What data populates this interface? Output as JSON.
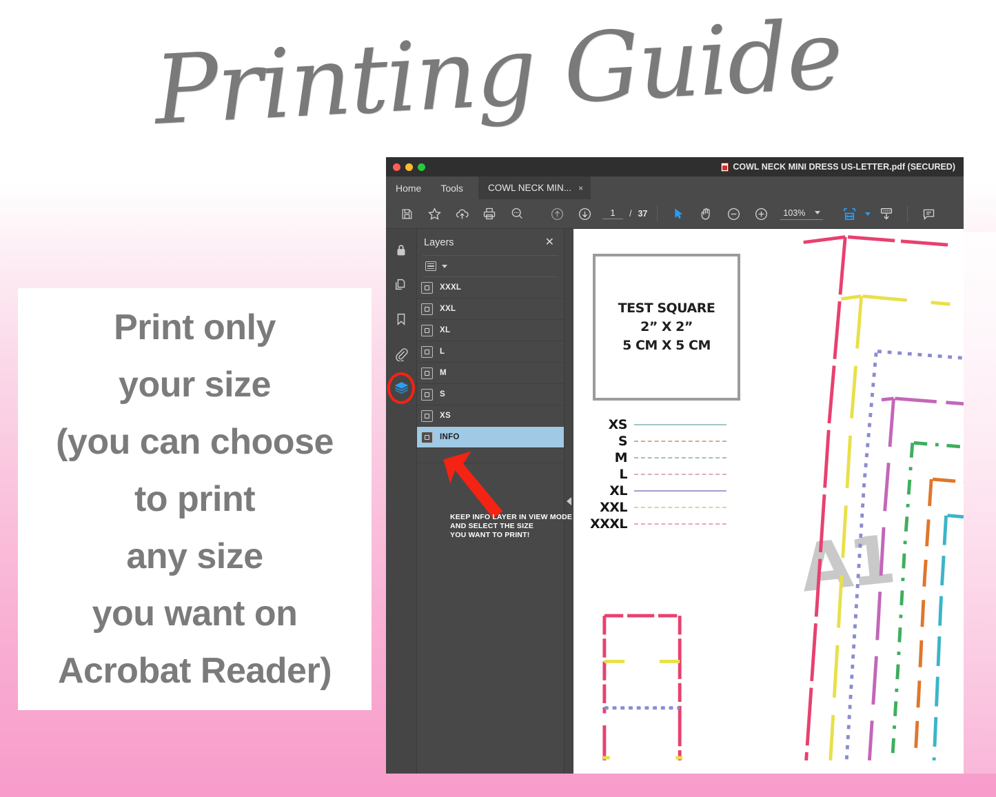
{
  "page": {
    "title": "Printing Guide",
    "bg_top": "#ffffff",
    "bg_bottom": "#f79ccb"
  },
  "info_card": {
    "text": "Print only\nyour size\n(you can choose\nto print\nany size\nyou want on\nAcrobat Reader)",
    "text_color": "#7b7b7b"
  },
  "window": {
    "doc_title": "COWL NECK MINI DRESS US-LETTER.pdf (SECURED)",
    "traffic_lights": [
      "close",
      "minimize",
      "maximize"
    ],
    "nav": {
      "home": "Home",
      "tools": "Tools"
    },
    "tab": {
      "label": "COWL NECK MIN...",
      "close": "×"
    },
    "toolbar": {
      "icons": [
        "save-icon",
        "star-icon",
        "cloud-upload-icon",
        "print-icon",
        "search-icon",
        "page-up-icon",
        "page-down-icon"
      ],
      "page_current": "1",
      "page_separator": "/",
      "page_total": "37",
      "right_icons": [
        "select-cursor-icon",
        "hand-icon",
        "zoom-out-icon",
        "zoom-in-icon"
      ],
      "zoom_value": "103%",
      "fit_icon": "fit-page-icon",
      "scroll_icon": "page-display-icon",
      "comment_icon": "comment-icon",
      "accent_color": "#2a9df4"
    },
    "rail": {
      "items": [
        {
          "name": "lock-icon",
          "label": "Security"
        },
        {
          "name": "pages-icon",
          "label": "Page Thumbnails"
        },
        {
          "name": "bookmark-icon",
          "label": "Bookmarks"
        },
        {
          "name": "paperclip-icon",
          "label": "Attachments"
        },
        {
          "name": "layers-icon",
          "label": "Layers"
        }
      ],
      "highlight_color": "#f42314",
      "active_color": "#2a9df4"
    },
    "panel": {
      "title": "Layers",
      "close": "✕",
      "options_icon": "list-options-icon",
      "layers": [
        {
          "label": "XXXL",
          "selected": false
        },
        {
          "label": "XXL",
          "selected": false
        },
        {
          "label": "XL",
          "selected": false
        },
        {
          "label": "L",
          "selected": false
        },
        {
          "label": "M",
          "selected": false
        },
        {
          "label": "S",
          "selected": false
        },
        {
          "label": "XS",
          "selected": false
        },
        {
          "label": "INFO",
          "selected": true
        }
      ],
      "selected_bg": "#9fc9e5",
      "annotation": "KEEP INFO LAYER IN VIEW MODE\nAND SELECT THE SIZE\nYOU WANT TO PRINT!",
      "annotation_color": "#ffffff",
      "arrow_color": "#f42314"
    },
    "document": {
      "test_square": "TEST SQUARE\n2” X 2”\n5 CM X 5 CM",
      "watermark": "A1",
      "size_legend": [
        {
          "label": "XS",
          "color": "#9fc4c9",
          "dash": "none"
        },
        {
          "label": "S",
          "color": "#d7a98c",
          "dash": "dashdot"
        },
        {
          "label": "M",
          "color": "#9fc4a8",
          "dash": "dashed"
        },
        {
          "label": "L",
          "color": "#d9aec2",
          "dash": "dashed-long"
        },
        {
          "label": "XL",
          "color": "#9f9fd0",
          "dash": "none"
        },
        {
          "label": "XXL",
          "color": "#dcd98f",
          "dash": "dashed-long"
        },
        {
          "label": "XXXL",
          "color": "#e8a5bd",
          "dash": "dashed-long"
        }
      ],
      "pattern_colors": [
        "#e8416f",
        "#e8e04a",
        "#8b8ccf",
        "#c267b8",
        "#3fae5e",
        "#e0762b",
        "#3bb5c9"
      ]
    }
  }
}
